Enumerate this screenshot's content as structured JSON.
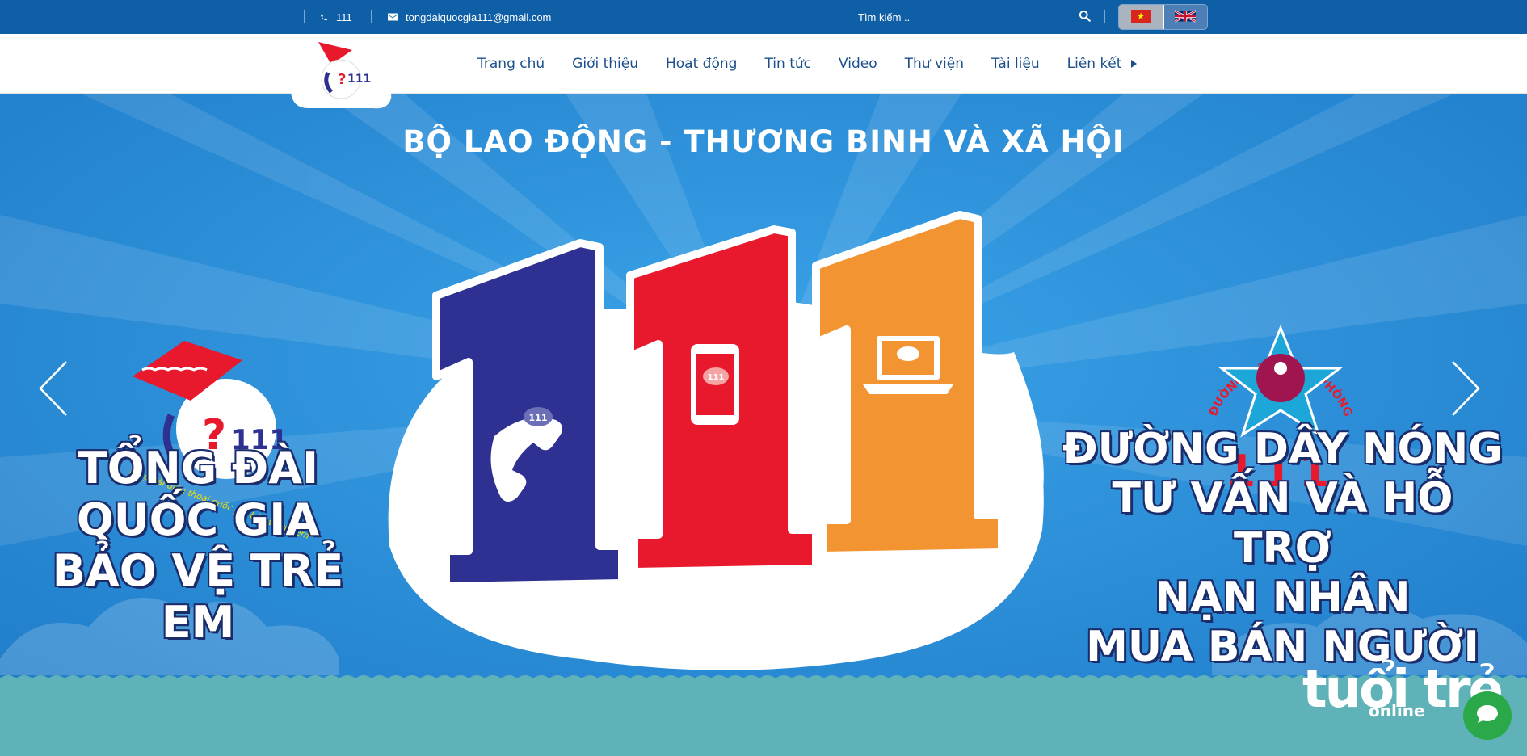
{
  "topbar": {
    "phone": "111",
    "email": "tongdaiquocgia111@gmail.com",
    "search_placeholder": "Tìm kiếm ..",
    "languages": [
      "vi-flag-icon",
      "uk-flag-icon"
    ]
  },
  "nav": {
    "items": [
      {
        "label": "Trang chủ"
      },
      {
        "label": "Giới thiệu"
      },
      {
        "label": "Hoạt động"
      },
      {
        "label": "Tin tức"
      },
      {
        "label": "Video"
      },
      {
        "label": "Thư viện"
      },
      {
        "label": "Tài liệu"
      },
      {
        "label": "Liên kết"
      }
    ]
  },
  "banner": {
    "title": "BỘ LAO ĐỘNG - THƯƠNG BINH VÀ XÃ HỘI",
    "big_number": [
      "1",
      "1",
      "1"
    ],
    "left_badge_number": "111",
    "left_badge_text": "Tổng đài điện thoại quốc gia bảo vệ trẻ em",
    "right_badge_arc": "ĐƯỜNG DÂY NÓNG PHÒNG, CHỐNG MUA BÁN NGƯỜI",
    "right_badge_number": "111",
    "left_slogan": [
      "TỔNG ĐÀI",
      "QUỐC GIA",
      "BẢO VỆ TRẺ EM"
    ],
    "right_slogan": [
      "ĐƯỜNG DÂY NÓNG",
      "TƯ VẤN VÀ HỖ TRỢ",
      "NẠN NHÂN",
      "MUA BÁN NGƯỜI"
    ],
    "watermark": "tuổi trẻ",
    "watermark_sub": "online"
  },
  "colors": {
    "topbar": "#0f5fa6",
    "nav_text": "#1b4f8c",
    "banner_blue": "#2a8fd6",
    "digit_navy": "#2e3192",
    "digit_red": "#e8192c",
    "digit_orange": "#f39432",
    "footer_teal": "#5fb3b8",
    "chat_green": "#2aa84a"
  }
}
